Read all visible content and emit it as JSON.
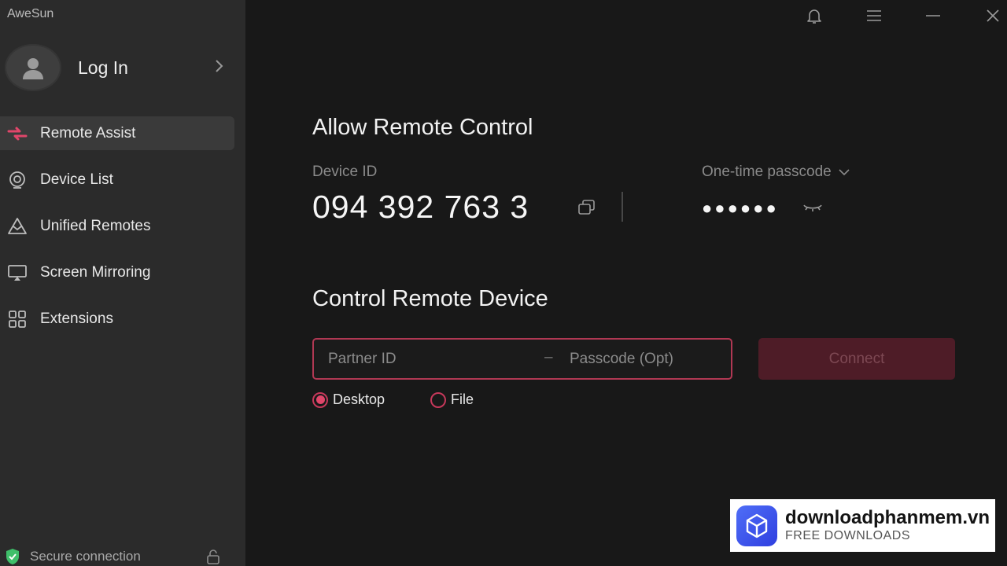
{
  "app": {
    "title": "AweSun"
  },
  "sidebar": {
    "login_label": "Log In",
    "items": [
      {
        "label": "Remote Assist",
        "icon": "remote-assist-icon",
        "active": true
      },
      {
        "label": "Device List",
        "icon": "device-list-icon",
        "active": false
      },
      {
        "label": "Unified Remotes",
        "icon": "unified-remotes-icon",
        "active": false
      },
      {
        "label": "Screen Mirroring",
        "icon": "screen-mirroring-icon",
        "active": false
      },
      {
        "label": "Extensions",
        "icon": "extensions-icon",
        "active": false
      }
    ],
    "secure_label": "Secure connection"
  },
  "allow": {
    "title": "Allow Remote Control",
    "device_id_label": "Device ID",
    "device_id": "094 392 763 3",
    "passcode_label": "One-time passcode",
    "passcode_masked": "●●●●●●"
  },
  "control": {
    "title": "Control Remote Device",
    "partner_placeholder": "Partner ID",
    "separator": "–",
    "passcode_placeholder": "Passcode (Opt)",
    "connect_label": "Connect",
    "modes": [
      {
        "label": "Desktop",
        "selected": true
      },
      {
        "label": "File",
        "selected": false
      }
    ]
  },
  "watermark": {
    "title": "downloadphanmem.vn",
    "subtitle": "FREE DOWNLOADS"
  },
  "colors": {
    "accent": "#e0466a",
    "sidebar_bg": "#2b2b2b",
    "main_bg": "#181818",
    "connect_bg": "#4e1c27"
  }
}
